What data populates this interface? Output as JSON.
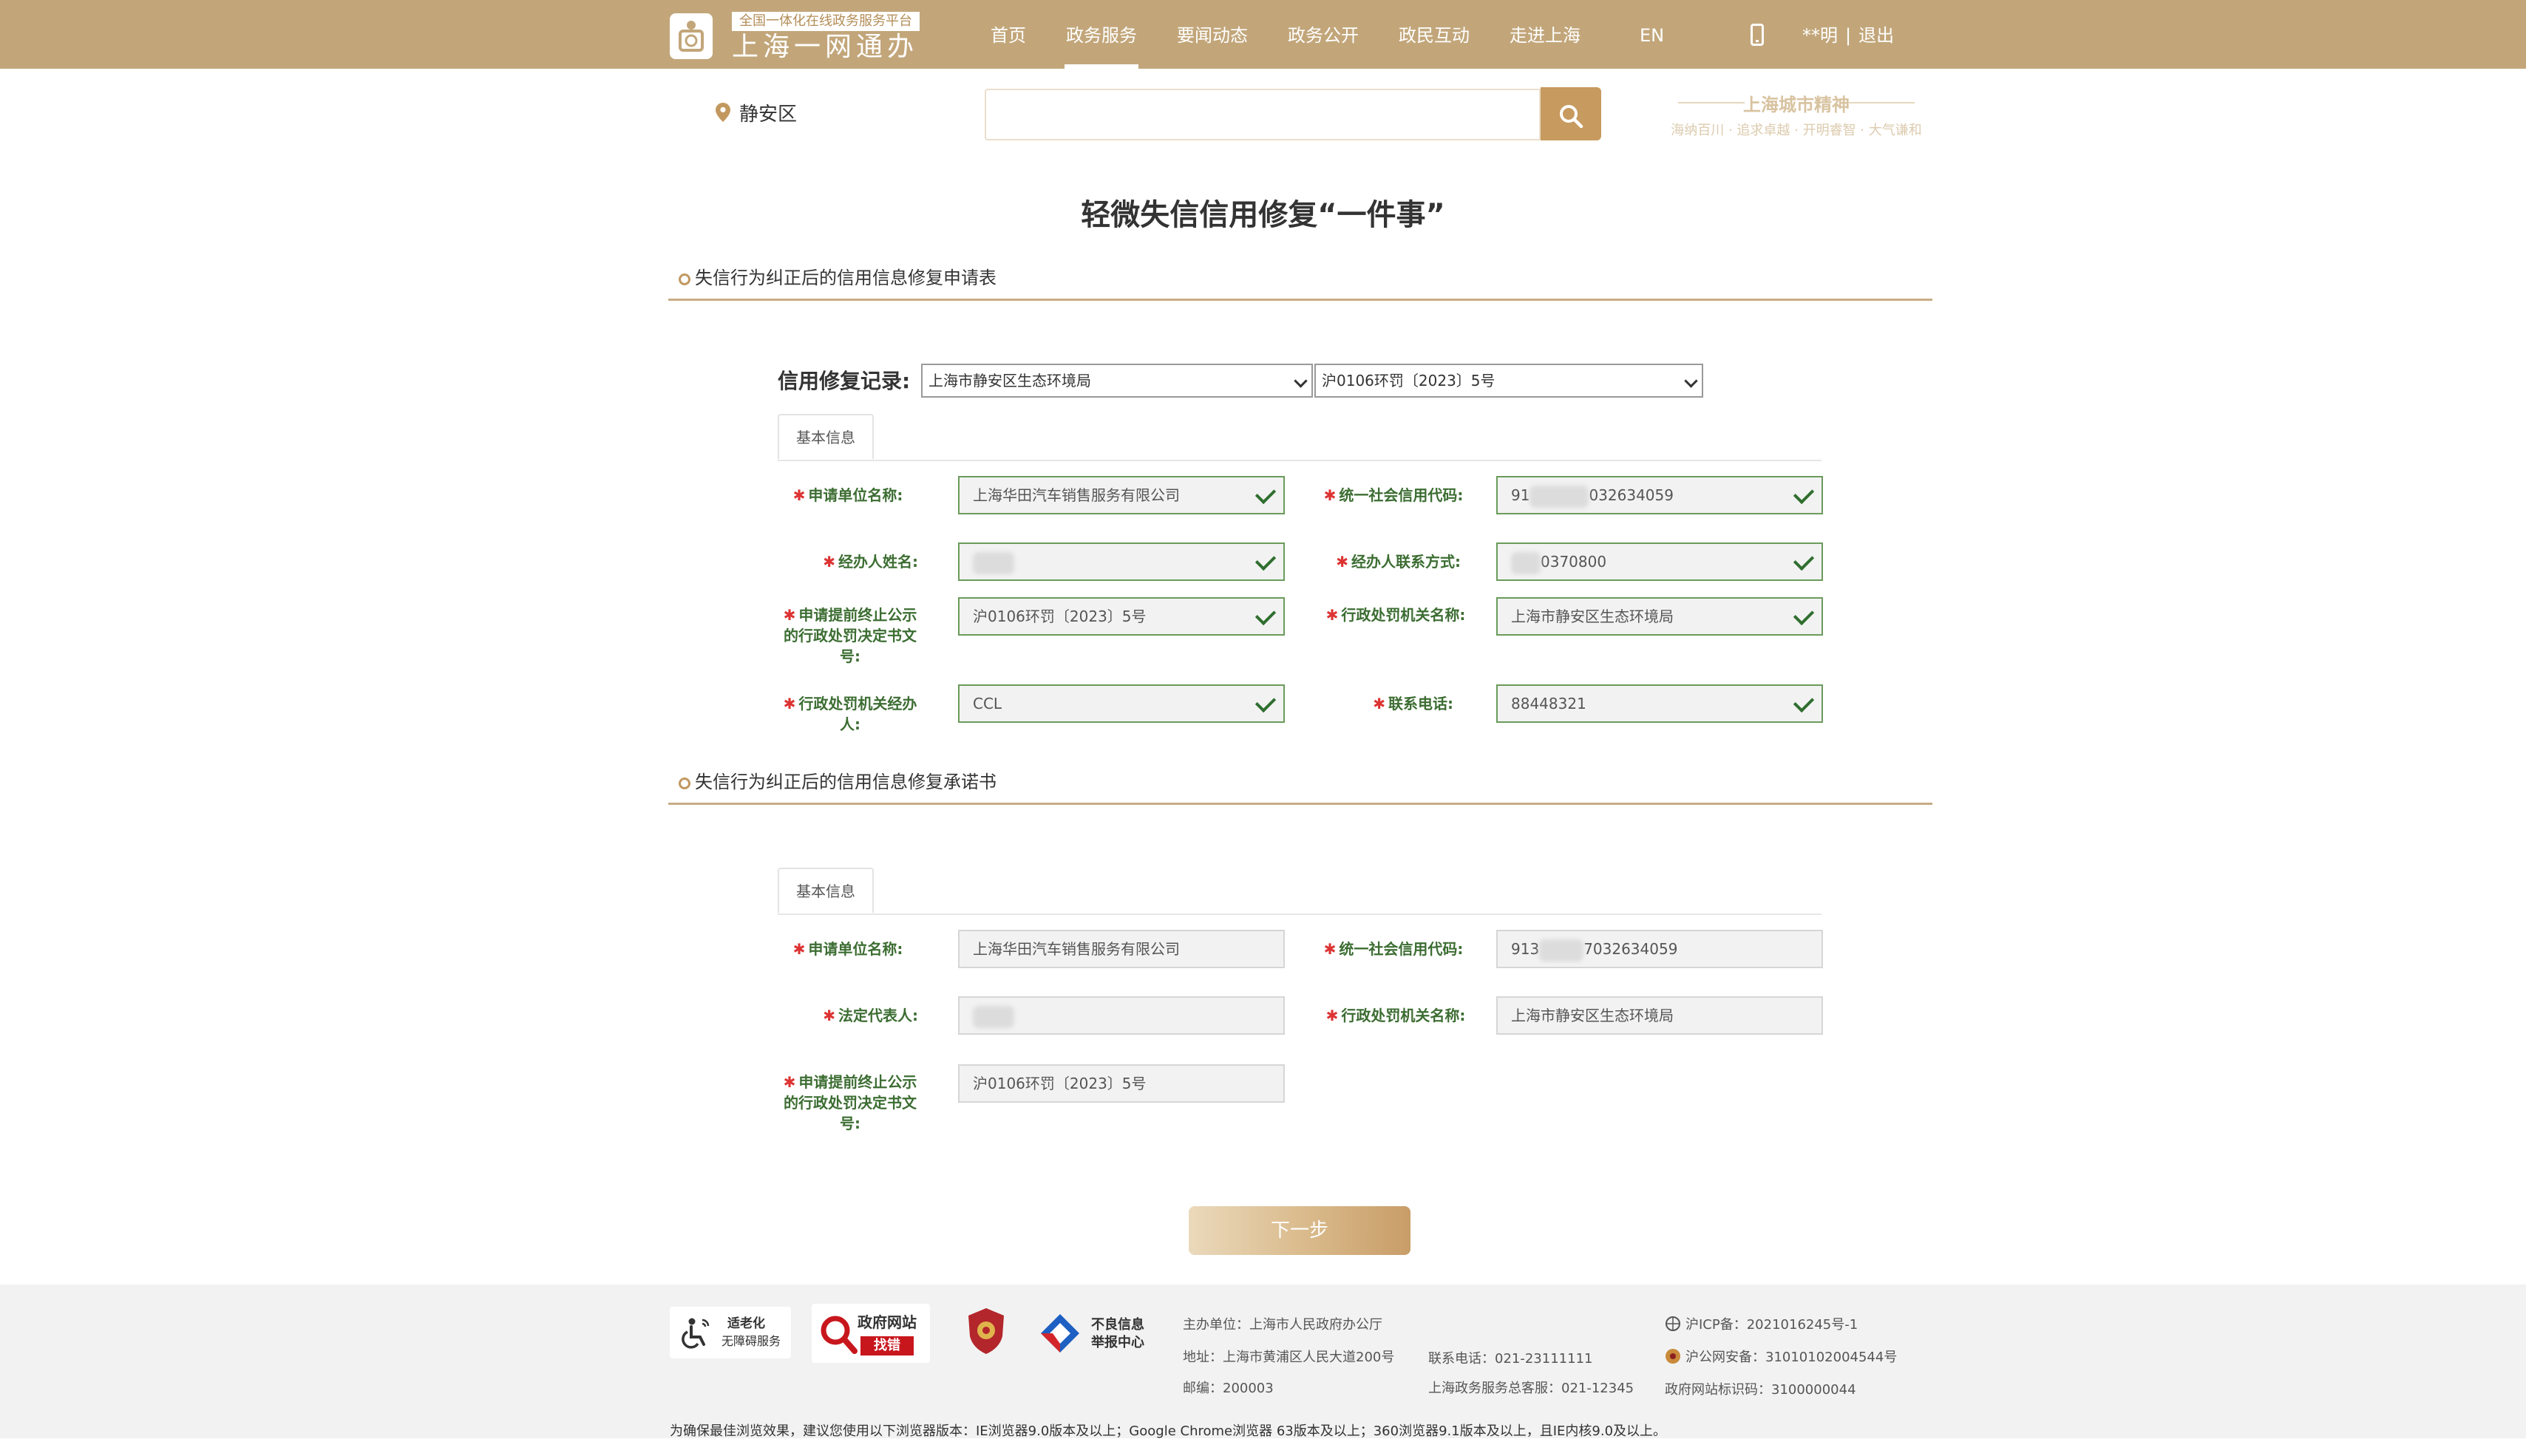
{
  "header": {
    "logo_slogan": "全国一体化在线政务服务平台",
    "logo_name": "上海一网通办",
    "nav": [
      "首页",
      "政务服务",
      "要闻动态",
      "政务公开",
      "政民互动",
      "走进上海"
    ],
    "nav_active_index": 1,
    "lang": "EN",
    "user_name": "**明",
    "separator": "|",
    "logout": "退出"
  },
  "location": "静安区",
  "search": {
    "placeholder": ""
  },
  "city_spirit": {
    "title": "上海城市精神",
    "subtitle": "海纳百川 · 追求卓越 · 开明睿智 · 大气谦和"
  },
  "page_title": "轻微失信信用修复“一件事”",
  "section1": {
    "title": "失信行为纠正后的信用信息修复申请表",
    "record_label": "信用修复记录:",
    "select_agency": "上海市静安区生态环境局",
    "select_decision": "沪0106环罚〔2023〕5号",
    "tab": "基本信息",
    "fields": {
      "applicant_label": "申请单位名称:",
      "applicant_value": "上海华田汽车销售服务有限公司",
      "credit_code_label": "统一社会信用代码:",
      "credit_code_prefix": "91",
      "credit_code_suffix": "032634059",
      "handler_label": "经办人姓名:",
      "handler_contact_label": "经办人联系方式:",
      "handler_contact_suffix": "0370800",
      "decision_label": "申请提前终止公示的行政处罚决定书文号:",
      "decision_value": "沪0106环罚〔2023〕5号",
      "agency_label": "行政处罚机关名称:",
      "agency_value": "上海市静安区生态环境局",
      "agency_handler_label": "行政处罚机关经办人:",
      "agency_handler_value": "CCL",
      "phone_label": "联系电话:",
      "phone_value": "88448321"
    }
  },
  "section2": {
    "title": "失信行为纠正后的信用信息修复承诺书",
    "tab": "基本信息",
    "fields": {
      "applicant_label": "申请单位名称:",
      "applicant_value": "上海华田汽车销售服务有限公司",
      "credit_code_label": "统一社会信用代码:",
      "credit_code_prefix": "913",
      "credit_code_suffix": "7032634059",
      "legal_rep_label": "法定代表人:",
      "agency_label": "行政处罚机关名称:",
      "agency_value": "上海市静安区生态环境局",
      "decision_label": "申请提前终止公示的行政处罚决定书文号:",
      "decision_value": "沪0106环罚〔2023〕5号"
    }
  },
  "next_button": "下一步",
  "footer": {
    "badge_elderly": [
      "适老化",
      "无障碍服务"
    ],
    "badge_gov": [
      "政府网站",
      "找错"
    ],
    "badge_report": [
      "不良信息",
      "举报中心"
    ],
    "sponsor": "主办单位：上海市人民政府办公厅",
    "address": "地址：上海市黄浦区人民大道200号",
    "postcode": "邮编：200003",
    "phone": "联系电话：021-23111111",
    "hotline": "上海政务服务总客服：021-12345",
    "icp": "沪ICP备：2021016245号-1",
    "police": "沪公网安备：31010102004544号",
    "site_code": "政府网站标识码：3100000044",
    "browser_note": "为确保最佳浏览效果，建议您使用以下浏览器版本：IE浏览器9.0版本及以上；Google Chrome浏览器 63版本及以上；360浏览器9.1版本及以上，且IE内核9.0及以上。"
  },
  "colors": {
    "topbar": "#c2a67a",
    "accent": "#c79a5f",
    "valid_border": "#6a9b5a",
    "required_star": "#dd3333"
  }
}
